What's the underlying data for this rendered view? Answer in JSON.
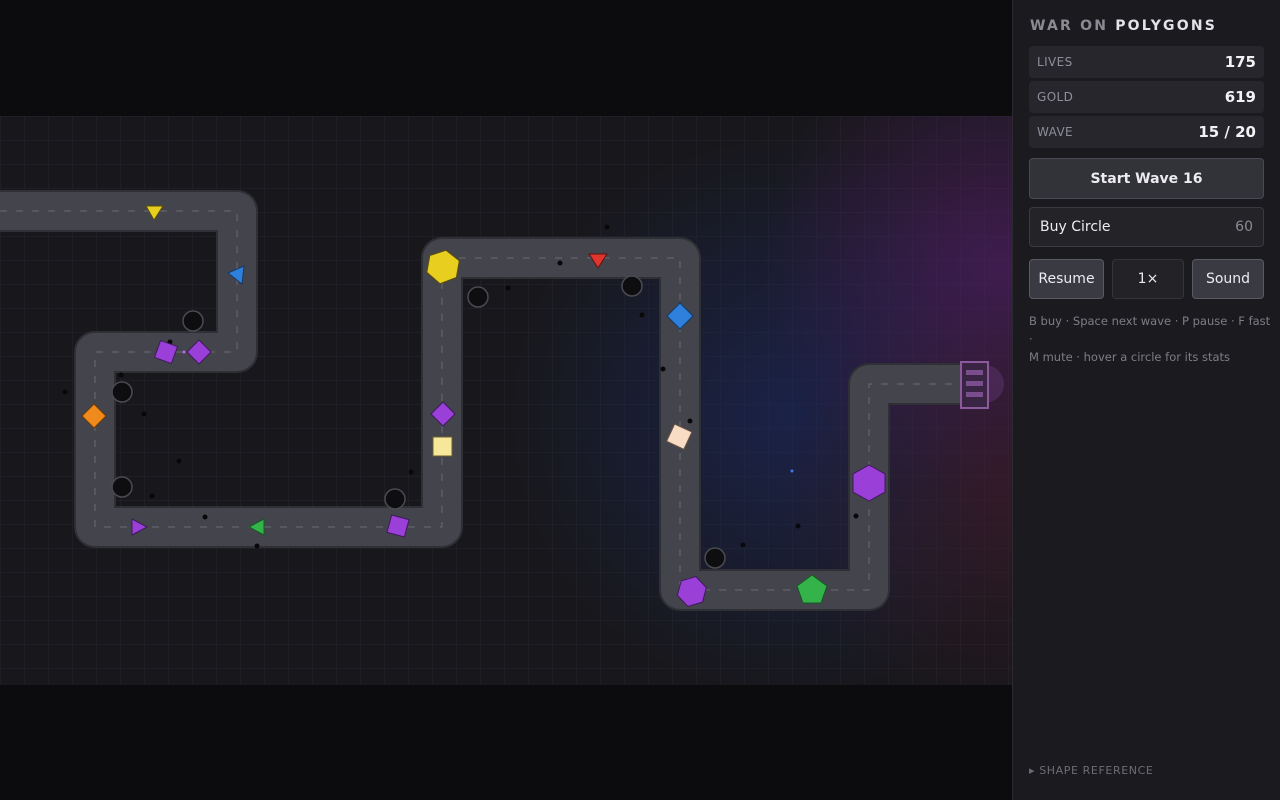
{
  "title": {
    "part1": "WAR ON",
    "part2": "POLYGONS"
  },
  "stats": [
    {
      "label": "LIVES",
      "value": "175"
    },
    {
      "label": "GOLD",
      "value": "619"
    },
    {
      "label": "WAVE",
      "value": "15 / 20"
    }
  ],
  "controls": {
    "start_wave": "Start Wave 16",
    "buy_label": "Buy Circle",
    "buy_cost": "60",
    "resume": "Resume",
    "speed": "1×",
    "sound": "Sound"
  },
  "help": {
    "line1": "B buy · Space next wave · P pause · F fast ·",
    "line2": "M mute · hover a circle for its stats"
  },
  "shape_reference": "▸ SHAPE REFERENCE",
  "colors": {
    "yellow": "#e8cf1f",
    "blue": "#2f7fdc",
    "purple": "#9a3fd8",
    "orange": "#f08a1c",
    "green": "#34b34a",
    "red": "#e0352c",
    "cream": "#f6e79a",
    "peach": "#f8dcc4",
    "path": "#3e3e47"
  },
  "towers": 8,
  "enemies": [
    {
      "shape": "triangle-down",
      "color": "yellow"
    },
    {
      "shape": "triangle-left",
      "color": "blue"
    },
    {
      "shape": "square",
      "color": "purple"
    },
    {
      "shape": "diamond",
      "color": "purple"
    },
    {
      "shape": "diamond",
      "color": "orange"
    },
    {
      "shape": "triangle-right",
      "color": "purple"
    },
    {
      "shape": "triangle-left",
      "color": "green"
    },
    {
      "shape": "square",
      "color": "purple"
    },
    {
      "shape": "diamond",
      "color": "purple"
    },
    {
      "shape": "square",
      "color": "cream"
    },
    {
      "shape": "hexagon",
      "color": "yellow"
    },
    {
      "shape": "triangle-down",
      "color": "red"
    },
    {
      "shape": "diamond",
      "color": "blue"
    },
    {
      "shape": "square",
      "color": "peach"
    },
    {
      "shape": "hexagon",
      "color": "purple"
    },
    {
      "shape": "pentagon",
      "color": "green"
    },
    {
      "shape": "hexagon",
      "color": "purple"
    }
  ]
}
